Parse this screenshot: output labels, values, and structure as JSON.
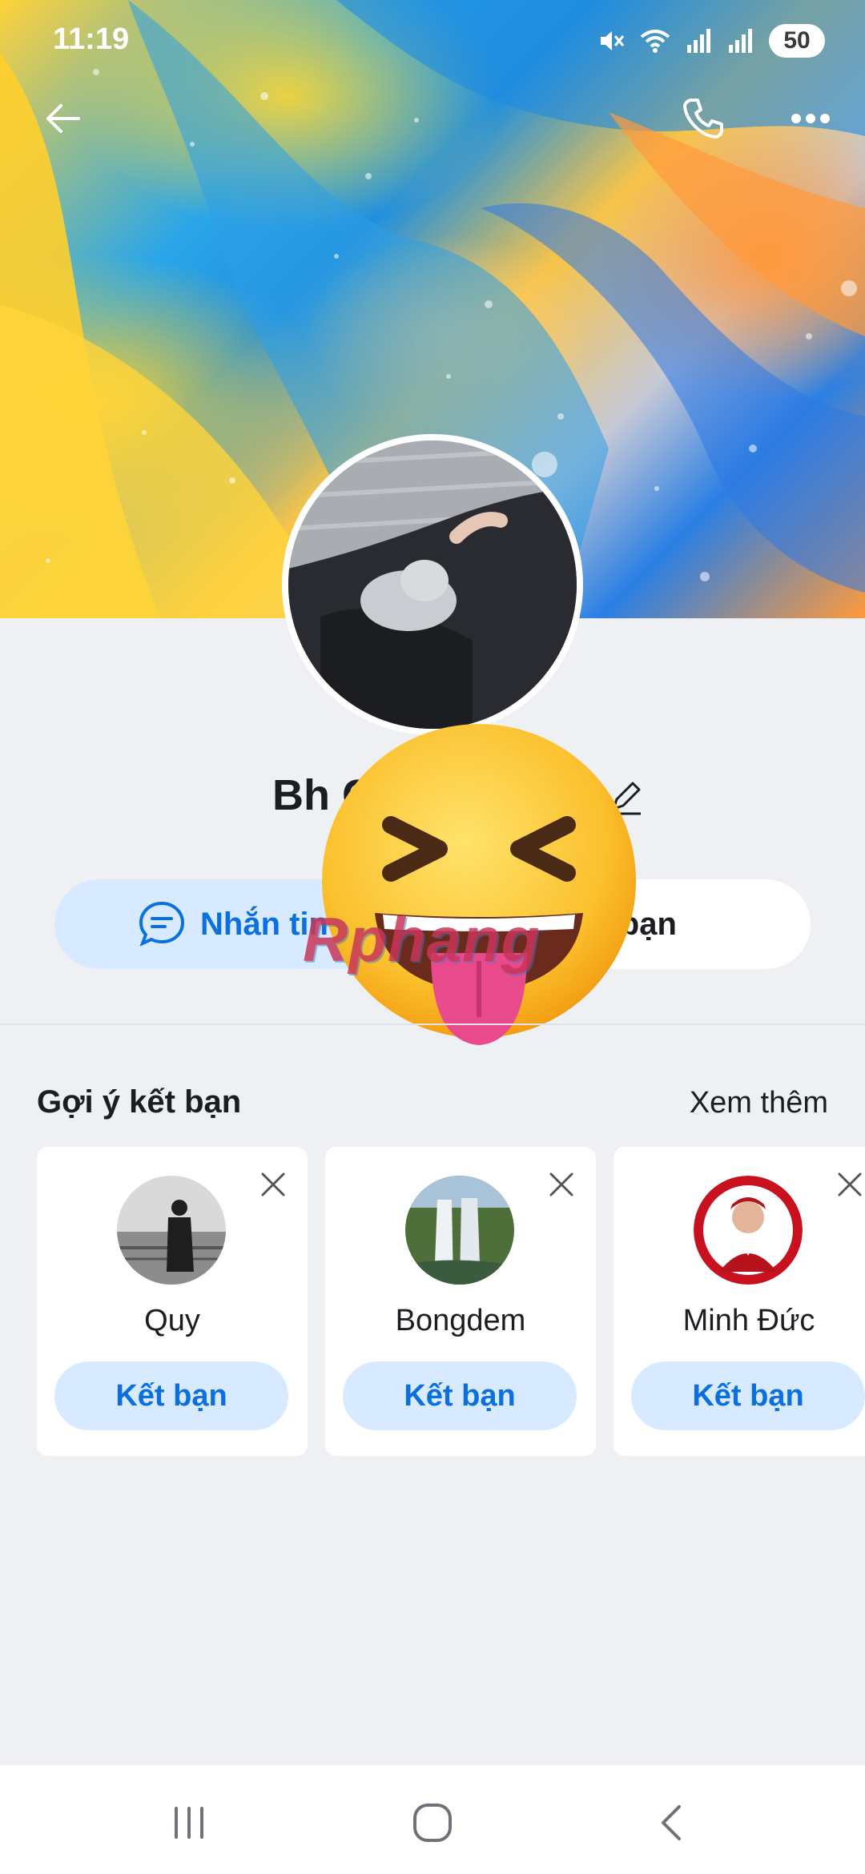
{
  "status_bar": {
    "time": "11:19",
    "battery": "50"
  },
  "cover": {
    "colors": [
      "#ffd23a",
      "#2aa6e8",
      "#ff9a3c",
      "#c7c9d6"
    ]
  },
  "top_actions": {
    "back_icon": "arrow-left-icon",
    "call_icon": "phone-icon",
    "more_icon": "more-horizontal-icon"
  },
  "profile": {
    "name": "Bh C",
    "edit_icon": "pencil-icon"
  },
  "actions": {
    "message_label": "Nhắn tin",
    "add_friend_label": "ết bạn"
  },
  "watermark": "Rphang",
  "suggestions": {
    "title": "Gợi ý kết bạn",
    "see_more": "Xem thêm",
    "items": [
      {
        "name": "Quy",
        "button": "Kết bạn"
      },
      {
        "name": "Bongdem",
        "button": "Kết bạn"
      },
      {
        "name": "Minh Đức",
        "button": "Kết bạn"
      }
    ]
  },
  "nav_bar": {
    "recents_icon": "recents-icon",
    "home_icon": "home-icon",
    "back_icon": "nav-back-icon"
  },
  "accent_colors": {
    "primary": "#0b6fe0",
    "button_bg": "#d8eaff",
    "page_bg": "#eef0f4"
  }
}
